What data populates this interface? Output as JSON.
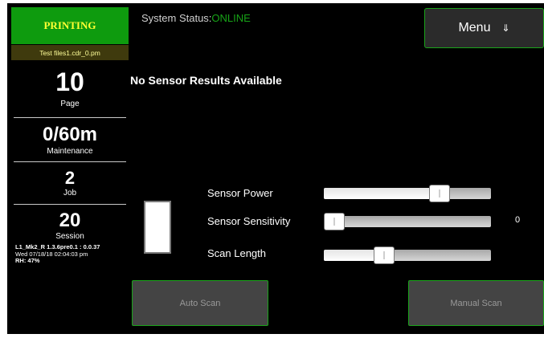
{
  "status_panel": {
    "state": "PRINTING",
    "file_name": "Test files1.cdr_0.pm",
    "page": {
      "value": "10",
      "label": "Page"
    },
    "maintenance": {
      "value": "0/60m",
      "label": "Maintenance"
    },
    "job": {
      "value": "2",
      "label": "Job"
    },
    "session": {
      "value": "20",
      "label": "Session"
    },
    "firmware": "L1_Mk2_R 1.3.6pre0.1 : 0.0.37",
    "datetime": "Wed 07/18/18 02:04:03 pm",
    "humidity": "RH: 47%"
  },
  "header": {
    "system_status_label": "System Status:",
    "system_status_value": "ONLINE",
    "menu_label": "Menu",
    "menu_arrow": "⇓"
  },
  "results_message": "No Sensor Results Available",
  "sliders": [
    {
      "label": "Sensor Power",
      "level": 0.72
    },
    {
      "label": "Sensor Sensitivity",
      "level": 0.0,
      "value_text": "0"
    },
    {
      "label": "Scan Length",
      "level": 0.34
    }
  ],
  "buttons": {
    "auto_scan": "Auto Scan",
    "manual_scan": "Manual Scan"
  },
  "colors": {
    "accent_green": "#1aa31a",
    "printing_bg": "#0e9b0e",
    "printing_text": "#ffff33",
    "online_text": "#17a317"
  }
}
